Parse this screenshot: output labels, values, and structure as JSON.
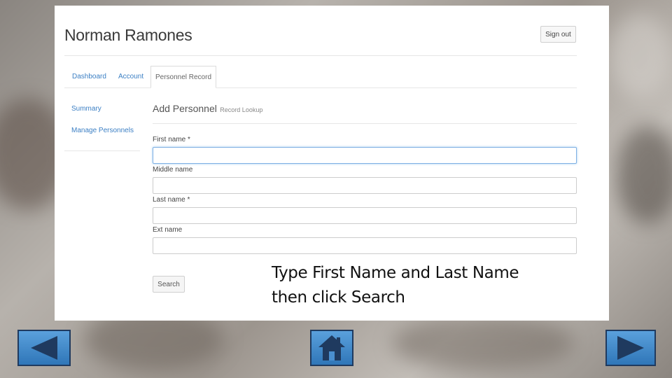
{
  "app": {
    "title": "Norman Ramones",
    "signout_label": "Sign out"
  },
  "tabs": [
    {
      "label": "Dashboard",
      "active": false
    },
    {
      "label": "Account",
      "active": false
    },
    {
      "label": "Personnel Record",
      "active": true
    }
  ],
  "sidebar": {
    "items": [
      {
        "label": "Summary"
      },
      {
        "label": "Manage Personnels"
      }
    ]
  },
  "form": {
    "title": "Add Personnel",
    "subtitle": "Record Lookup",
    "fields": [
      {
        "label": "First name *",
        "value": "",
        "focused": true
      },
      {
        "label": "Middle name",
        "value": "",
        "focused": false
      },
      {
        "label": "Last name *",
        "value": "",
        "focused": false
      },
      {
        "label": "Ext name",
        "value": "",
        "focused": false
      }
    ],
    "search_label": "Search"
  },
  "instruction": {
    "line1": "Type First Name and Last Name",
    "line2": "then click Search"
  },
  "navigation": {
    "back_icon": "triangle-left-icon",
    "home_icon": "house-icon",
    "next_icon": "triangle-right-icon",
    "button_color": "#2f76b8",
    "icon_color": "#1f3a5f"
  }
}
